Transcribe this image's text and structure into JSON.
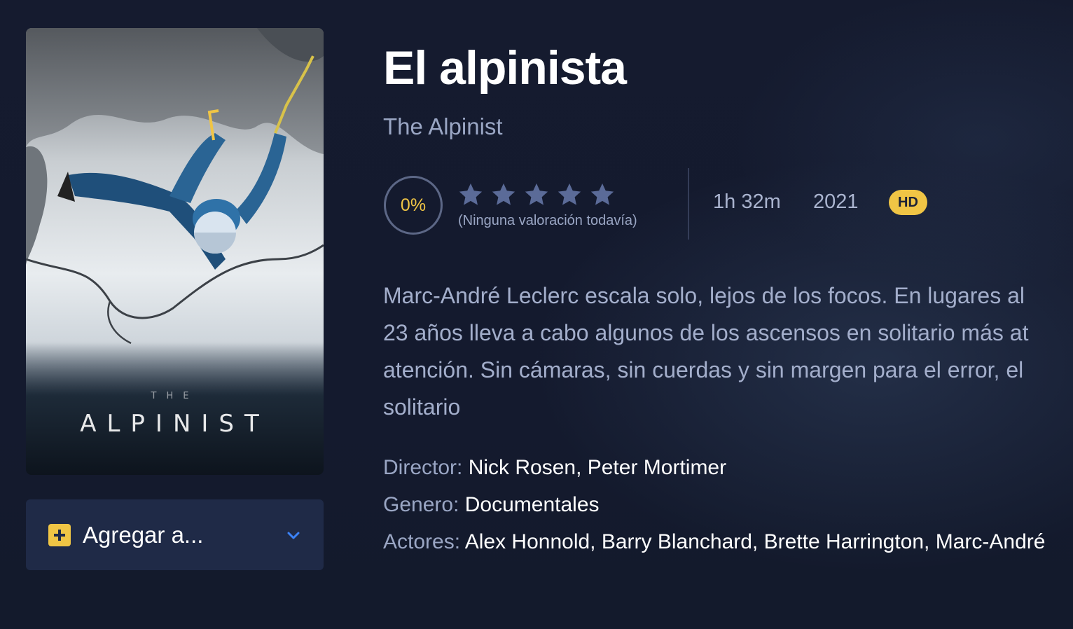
{
  "poster": {
    "sub_text": "THE",
    "title_text": "ALPINIST"
  },
  "add_to": {
    "label": "Agregar a...",
    "icon": "plus-square-icon",
    "chevron": "chevron-down-icon",
    "icon_color": "#f0c545",
    "chevron_color": "#3b82f6"
  },
  "movie": {
    "title": "El alpinista",
    "original_title": "The Alpinist",
    "rating_percent": "0%",
    "stars_filled": 0,
    "stars_total": 5,
    "no_rating_text": "(Ninguna valoración todavía)",
    "duration": "1h 32m",
    "year": "2021",
    "quality": "HD",
    "synopsis_lines": [
      "Marc-André Leclerc escala solo, lejos de los focos. En lugares al",
      "23 años lleva a cabo algunos de los ascensos en solitario más at",
      "atención. Sin cámaras, sin cuerdas y sin margen para el error, el",
      "solitario"
    ],
    "director_label": "Director:",
    "director": "Nick Rosen, Peter Mortimer",
    "genre_label": "Genero:",
    "genre": "Documentales",
    "actors_label": "Actores:",
    "actors": "Alex Honnold, Barry Blanchard, Brette Harrington, Marc-André"
  },
  "colors": {
    "background": "#141a2e",
    "accent": "#f0c545",
    "muted_text": "#9aa6c4",
    "star": "#5b6b98"
  }
}
